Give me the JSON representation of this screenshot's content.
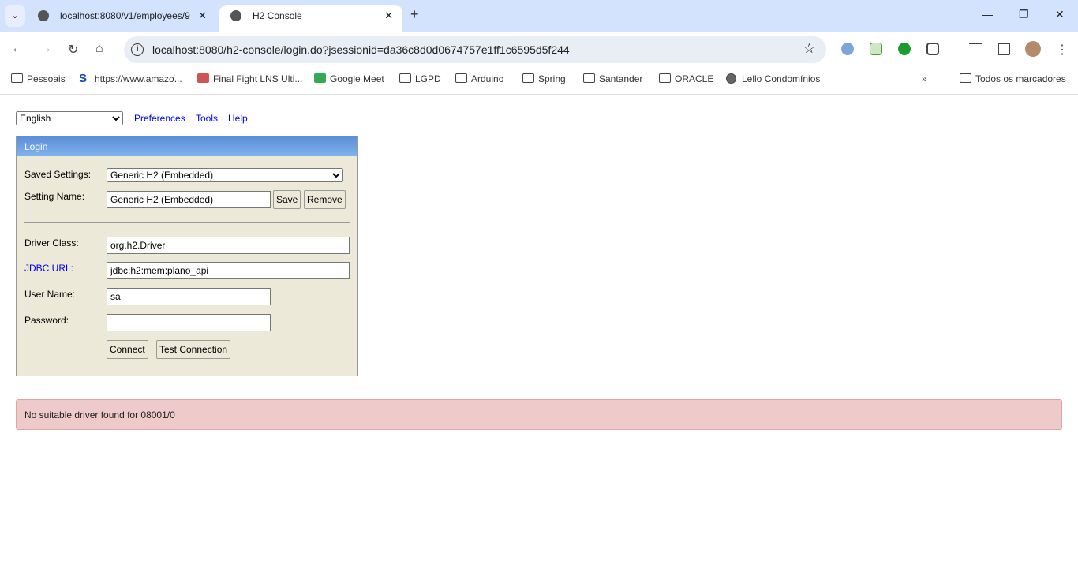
{
  "browser": {
    "tabs": [
      {
        "title": "localhost:8080/v1/employees/9"
      },
      {
        "title": "H2 Console"
      }
    ],
    "url": "localhost:8080/h2-console/login.do?jsessionid=da36c8d0d0674757e1ff1c6595d5f244",
    "bookmarks": [
      "Pessoais",
      "https://www.amazo...",
      "Final Fight LNS Ulti...",
      "Google Meet",
      "LGPD",
      "Arduino",
      "Spring",
      "Santander",
      "ORACLE",
      "Lello Condomínios"
    ],
    "all_bookmarks": "Todos os marcadores"
  },
  "top": {
    "language": "English",
    "links": [
      "Preferences",
      "Tools",
      "Help"
    ]
  },
  "login": {
    "title": "Login",
    "saved_settings_label": "Saved Settings:",
    "saved_settings_value": "Generic H2 (Embedded)",
    "setting_name_label": "Setting Name:",
    "setting_name_value": "Generic H2 (Embedded)",
    "save": "Save",
    "remove": "Remove",
    "driver_label": "Driver Class:",
    "driver_value": "org.h2.Driver",
    "jdbc_label": "JDBC URL:",
    "jdbc_value": "jdbc:h2:mem:plano_api",
    "user_label": "User Name:",
    "user_value": "sa",
    "password_label": "Password:",
    "password_value": "",
    "connect": "Connect",
    "test": "Test Connection"
  },
  "error": "No suitable driver found for 08001/0"
}
